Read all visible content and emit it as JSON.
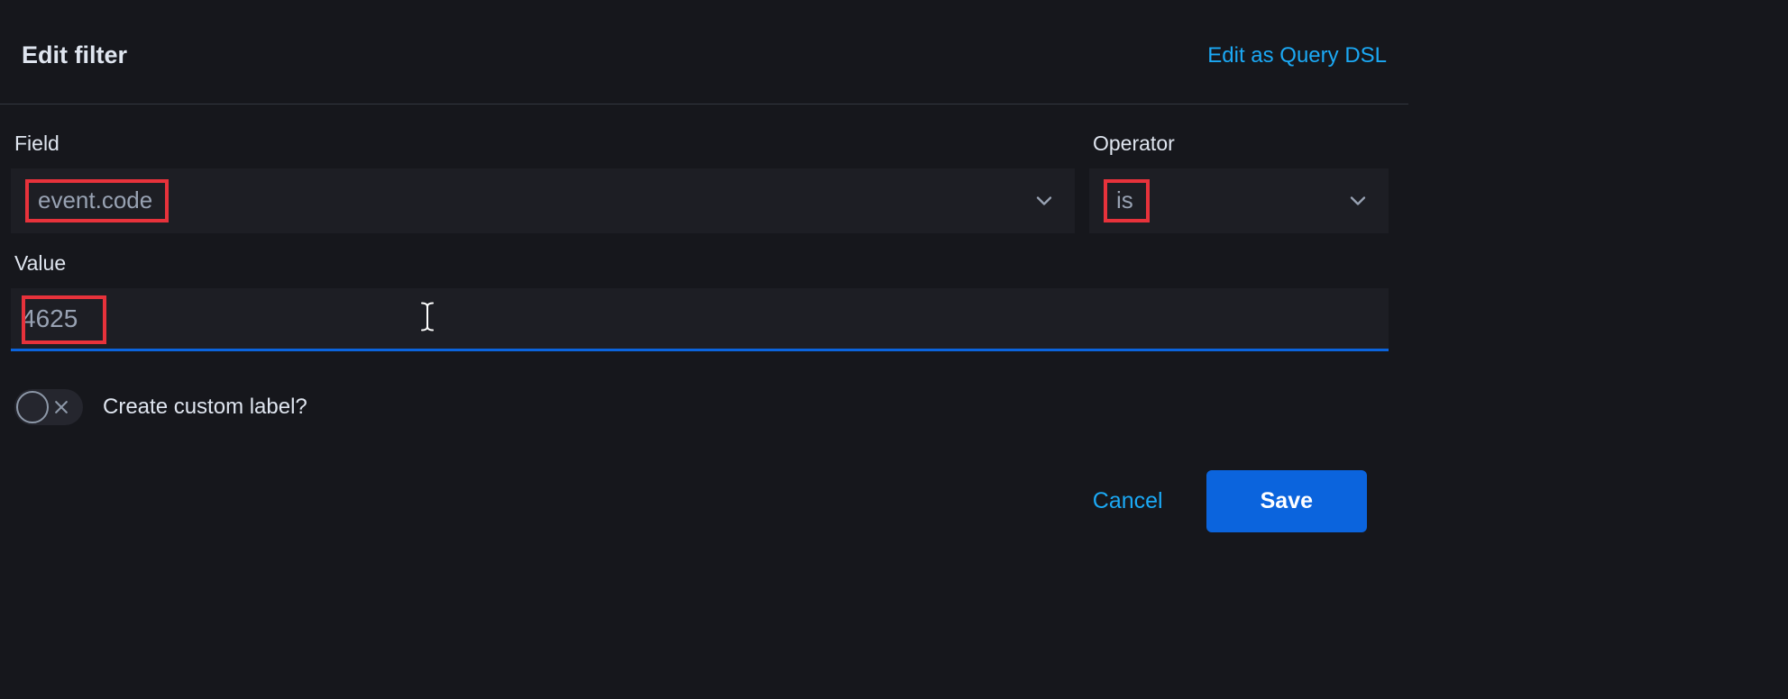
{
  "header": {
    "title": "Edit filter",
    "dsl_link": "Edit as Query DSL"
  },
  "labels": {
    "field": "Field",
    "operator": "Operator",
    "value": "Value",
    "custom_label": "Create custom label?"
  },
  "field": {
    "value": "event.code"
  },
  "operator": {
    "value": "is"
  },
  "value": {
    "value": "4625"
  },
  "toggle": {
    "custom_label_on": false
  },
  "footer": {
    "cancel": "Cancel",
    "save": "Save"
  },
  "highlight_color": "#e7323b"
}
